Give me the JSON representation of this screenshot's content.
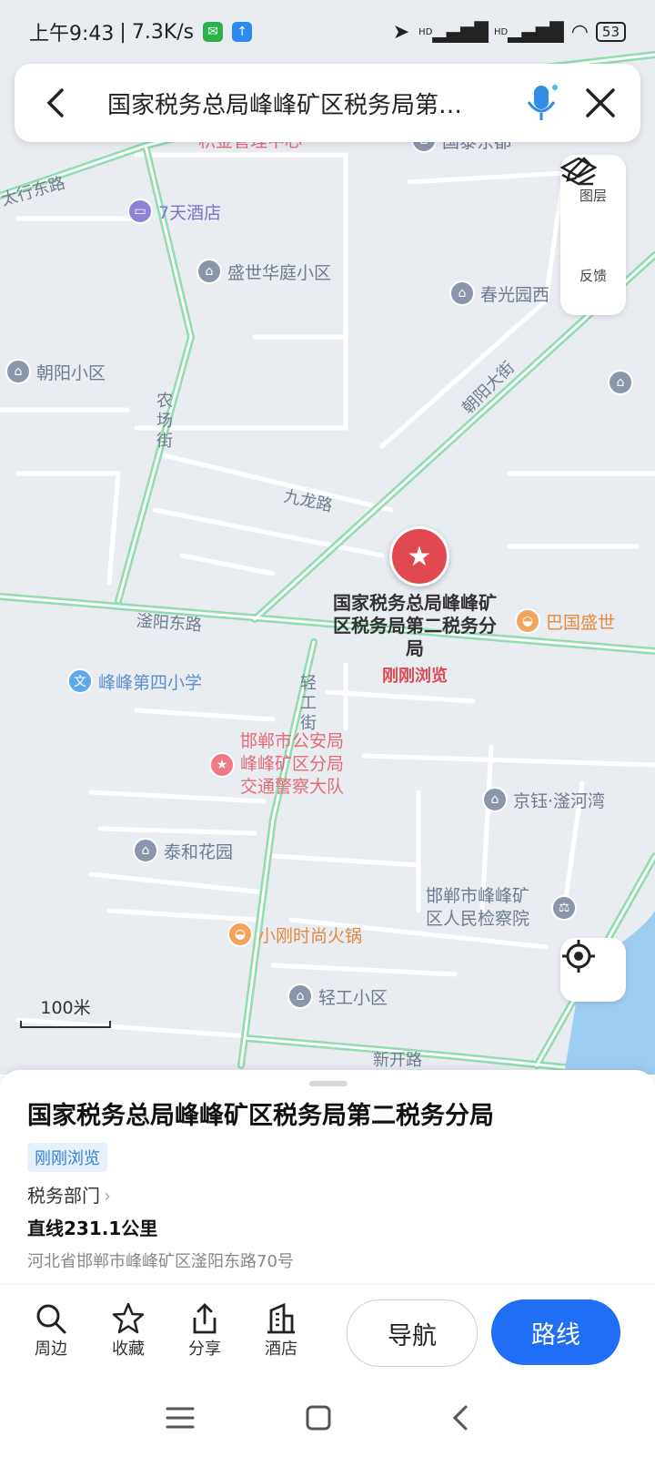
{
  "status": {
    "time": "上午9:43",
    "speed": "7.3K/s",
    "hd1": "HD",
    "hd2": "HD",
    "battery": "53"
  },
  "search": {
    "query": "国家税务总局峰峰矿区税务局第…"
  },
  "tools": {
    "layers": "图层",
    "feedback": "反馈"
  },
  "map": {
    "roads": {
      "taihang": "太行东路",
      "nongchang": "农场街",
      "jiulong": "九龙路",
      "chaoyang_st": "朝阳大街",
      "fuyang": "滏阳东路",
      "qinggong": "轻工街",
      "xinkai": "新开路"
    },
    "pois": {
      "jijin": "积金管理中心",
      "guotai": "国泰东都",
      "hotel7": "7天酒店",
      "shengshi": "盛世华庭小区",
      "chunguang": "春光园西",
      "chaoyang": "朝阳小区",
      "baguo": "巴国盛世",
      "school4": "峰峰第四小学",
      "police": "邯郸市公安局峰峰矿区分局交通警察大队",
      "jingyu": "京钰·滏河湾",
      "taihe": "泰和花园",
      "procuratorate": "邯郸市峰峰矿区人民检察院",
      "hotpot": "小刚时尚火锅",
      "qinggong_xq": "轻工小区"
    },
    "marker": {
      "label": "国家税务总局峰峰矿区税务局第二税务分局",
      "recent": "刚刚浏览"
    },
    "scale": "100米"
  },
  "place": {
    "title": "国家税务总局峰峰矿区税务局第二税务分局",
    "tag": "刚刚浏览",
    "category": "税务部门",
    "distance": "直线231.1公里",
    "address": "河北省邯郸市峰峰矿区滏阳东路70号"
  },
  "actions": {
    "nearby": "周边",
    "favorite": "收藏",
    "share": "分享",
    "hotel": "酒店",
    "navigate": "导航",
    "route": "路线"
  },
  "colors": {
    "accent": "#1f6ef5",
    "marker": "#e2494f",
    "road": "#8fdcaf"
  }
}
